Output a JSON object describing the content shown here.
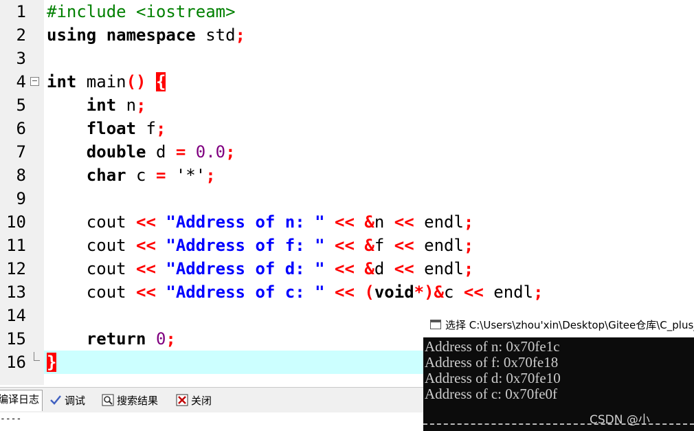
{
  "editor": {
    "line_numbers": [
      "1",
      "2",
      "3",
      "4",
      "5",
      "6",
      "7",
      "8",
      "9",
      "10",
      "11",
      "12",
      "13",
      "14",
      "15",
      "16"
    ],
    "lines": {
      "l1": {
        "a": "#include <iostream>"
      },
      "l2": {
        "a": "using namespace",
        "b": " std",
        "c": ";"
      },
      "l4": {
        "a": "int",
        "b": " main",
        "c": "()",
        "d": " ",
        "e": "{"
      },
      "l5": {
        "a": "    int",
        "b": " n",
        "c": ";"
      },
      "l6": {
        "a": "    float",
        "b": " f",
        "c": ";"
      },
      "l7": {
        "a": "    double",
        "b": " d ",
        "c": "=",
        "d": " 0.0",
        "e": ";"
      },
      "l8": {
        "a": "    char",
        "b": " c ",
        "c": "=",
        "d": " '*'",
        "e": ";"
      },
      "l10": {
        "a": "    cout ",
        "b": "<<",
        "c": " \"Address of n: \"",
        "d": " <<",
        "e": " &",
        "f": "n",
        "g": " <<",
        "h": " endl",
        "i": ";"
      },
      "l11": {
        "a": "    cout ",
        "b": "<<",
        "c": " \"Address of f: \"",
        "d": " <<",
        "e": " &",
        "f": "f",
        "g": " <<",
        "h": " endl",
        "i": ";"
      },
      "l12": {
        "a": "    cout ",
        "b": "<<",
        "c": " \"Address of d: \"",
        "d": " <<",
        "e": " &",
        "f": "d",
        "g": " <<",
        "h": " endl",
        "i": ";"
      },
      "l13": {
        "a": "    cout ",
        "b": "<<",
        "c": " \"Address of c: \"",
        "d": " <<",
        "e": " (",
        "f": "void",
        "g": "*)&",
        "h": "c",
        "i": " <<",
        "j": " endl",
        "k": ";"
      },
      "l15": {
        "a": "    return",
        "b": " 0",
        "c": ";"
      },
      "l16": {
        "a": "}"
      }
    }
  },
  "bottom_tabs": {
    "compile_log": "编译日志",
    "debug": "调试",
    "search_results": "搜索结果",
    "close": "关闭"
  },
  "log_text": "----",
  "console": {
    "title": "选择 C:\\Users\\zhou'xin\\Desktop\\Gitee仓库\\C_plus_",
    "output": [
      "Address of n: 0x70fe1c",
      "Address of f: 0x70fe18",
      "Address of d: 0x70fe10",
      "Address of c: 0x70fe0f"
    ],
    "watermark": "CSDN @小"
  },
  "colors": {
    "keyword": "#000000",
    "preprocessor": "#008000",
    "operator": "#ff0000",
    "string": "#0000ff",
    "number": "#800080",
    "current_line": "#ccffff",
    "console_bg": "#0c0c0c"
  }
}
